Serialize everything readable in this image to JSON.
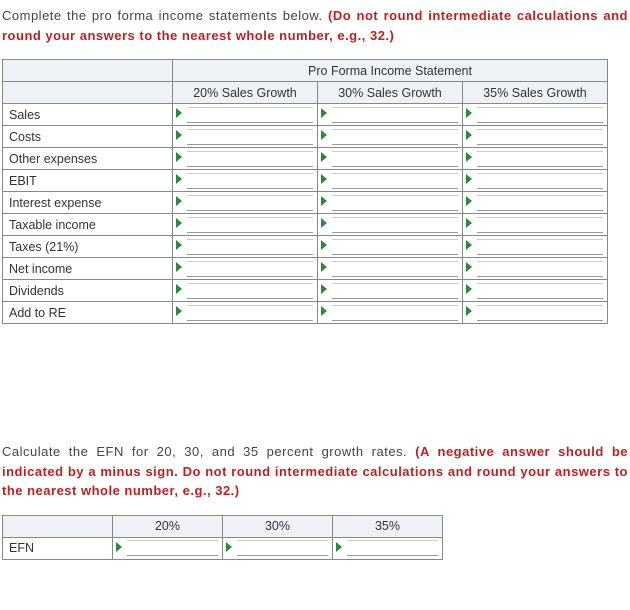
{
  "instruction1": {
    "plain": "Complete the pro forma income statements below. ",
    "red": "(Do not round intermediate calculations and round your answers to the nearest whole number, e.g., 32.)"
  },
  "table1": {
    "title": "Pro Forma Income Statement",
    "cols": [
      "20% Sales Growth",
      "30% Sales Growth",
      "35% Sales Growth"
    ],
    "rows": [
      "Sales",
      "Costs",
      "Other expenses",
      "EBIT",
      "Interest expense",
      "Taxable income",
      "Taxes (21%)",
      "Net income",
      "Dividends",
      "Add to RE"
    ]
  },
  "instruction2": {
    "plain": "Calculate the EFN for 20, 30, and 35 percent growth rates. ",
    "red": "(A negative answer should be indicated by a minus sign. Do not round intermediate calculations and round your answers to the nearest whole number, e.g., 32.)"
  },
  "table2": {
    "cols": [
      "20%",
      "30%",
      "35%"
    ],
    "rows": [
      "EFN"
    ]
  }
}
